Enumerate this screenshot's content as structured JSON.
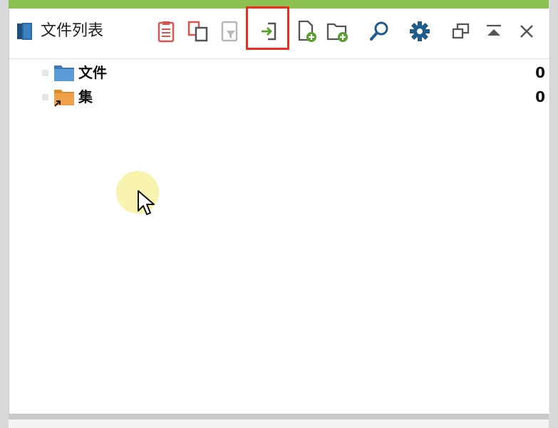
{
  "panel": {
    "title": "文件列表"
  },
  "toolbar": {
    "icons": [
      "paste-icon",
      "copy-icon",
      "filter-icon",
      "import-icon",
      "new-file-icon",
      "new-folder-icon",
      "search-icon",
      "settings-icon",
      "restore-window-icon",
      "collapse-icon",
      "close-icon"
    ],
    "highlighted": "import-icon",
    "highlight_color": "#ef2b24"
  },
  "tree": {
    "rows": [
      {
        "label": "文件",
        "count": "0",
        "icon": "folder-blue-icon"
      },
      {
        "label": "集",
        "count": "0",
        "icon": "folder-orange-shortcut-icon"
      }
    ]
  },
  "colors": {
    "accent_bar": "#8cc152",
    "icon_red": "#d9534f",
    "icon_green": "#5a9e2f",
    "icon_blue": "#1f5b8c",
    "folder_blue": "#5b9bd5",
    "folder_orange": "#f0a04b"
  }
}
